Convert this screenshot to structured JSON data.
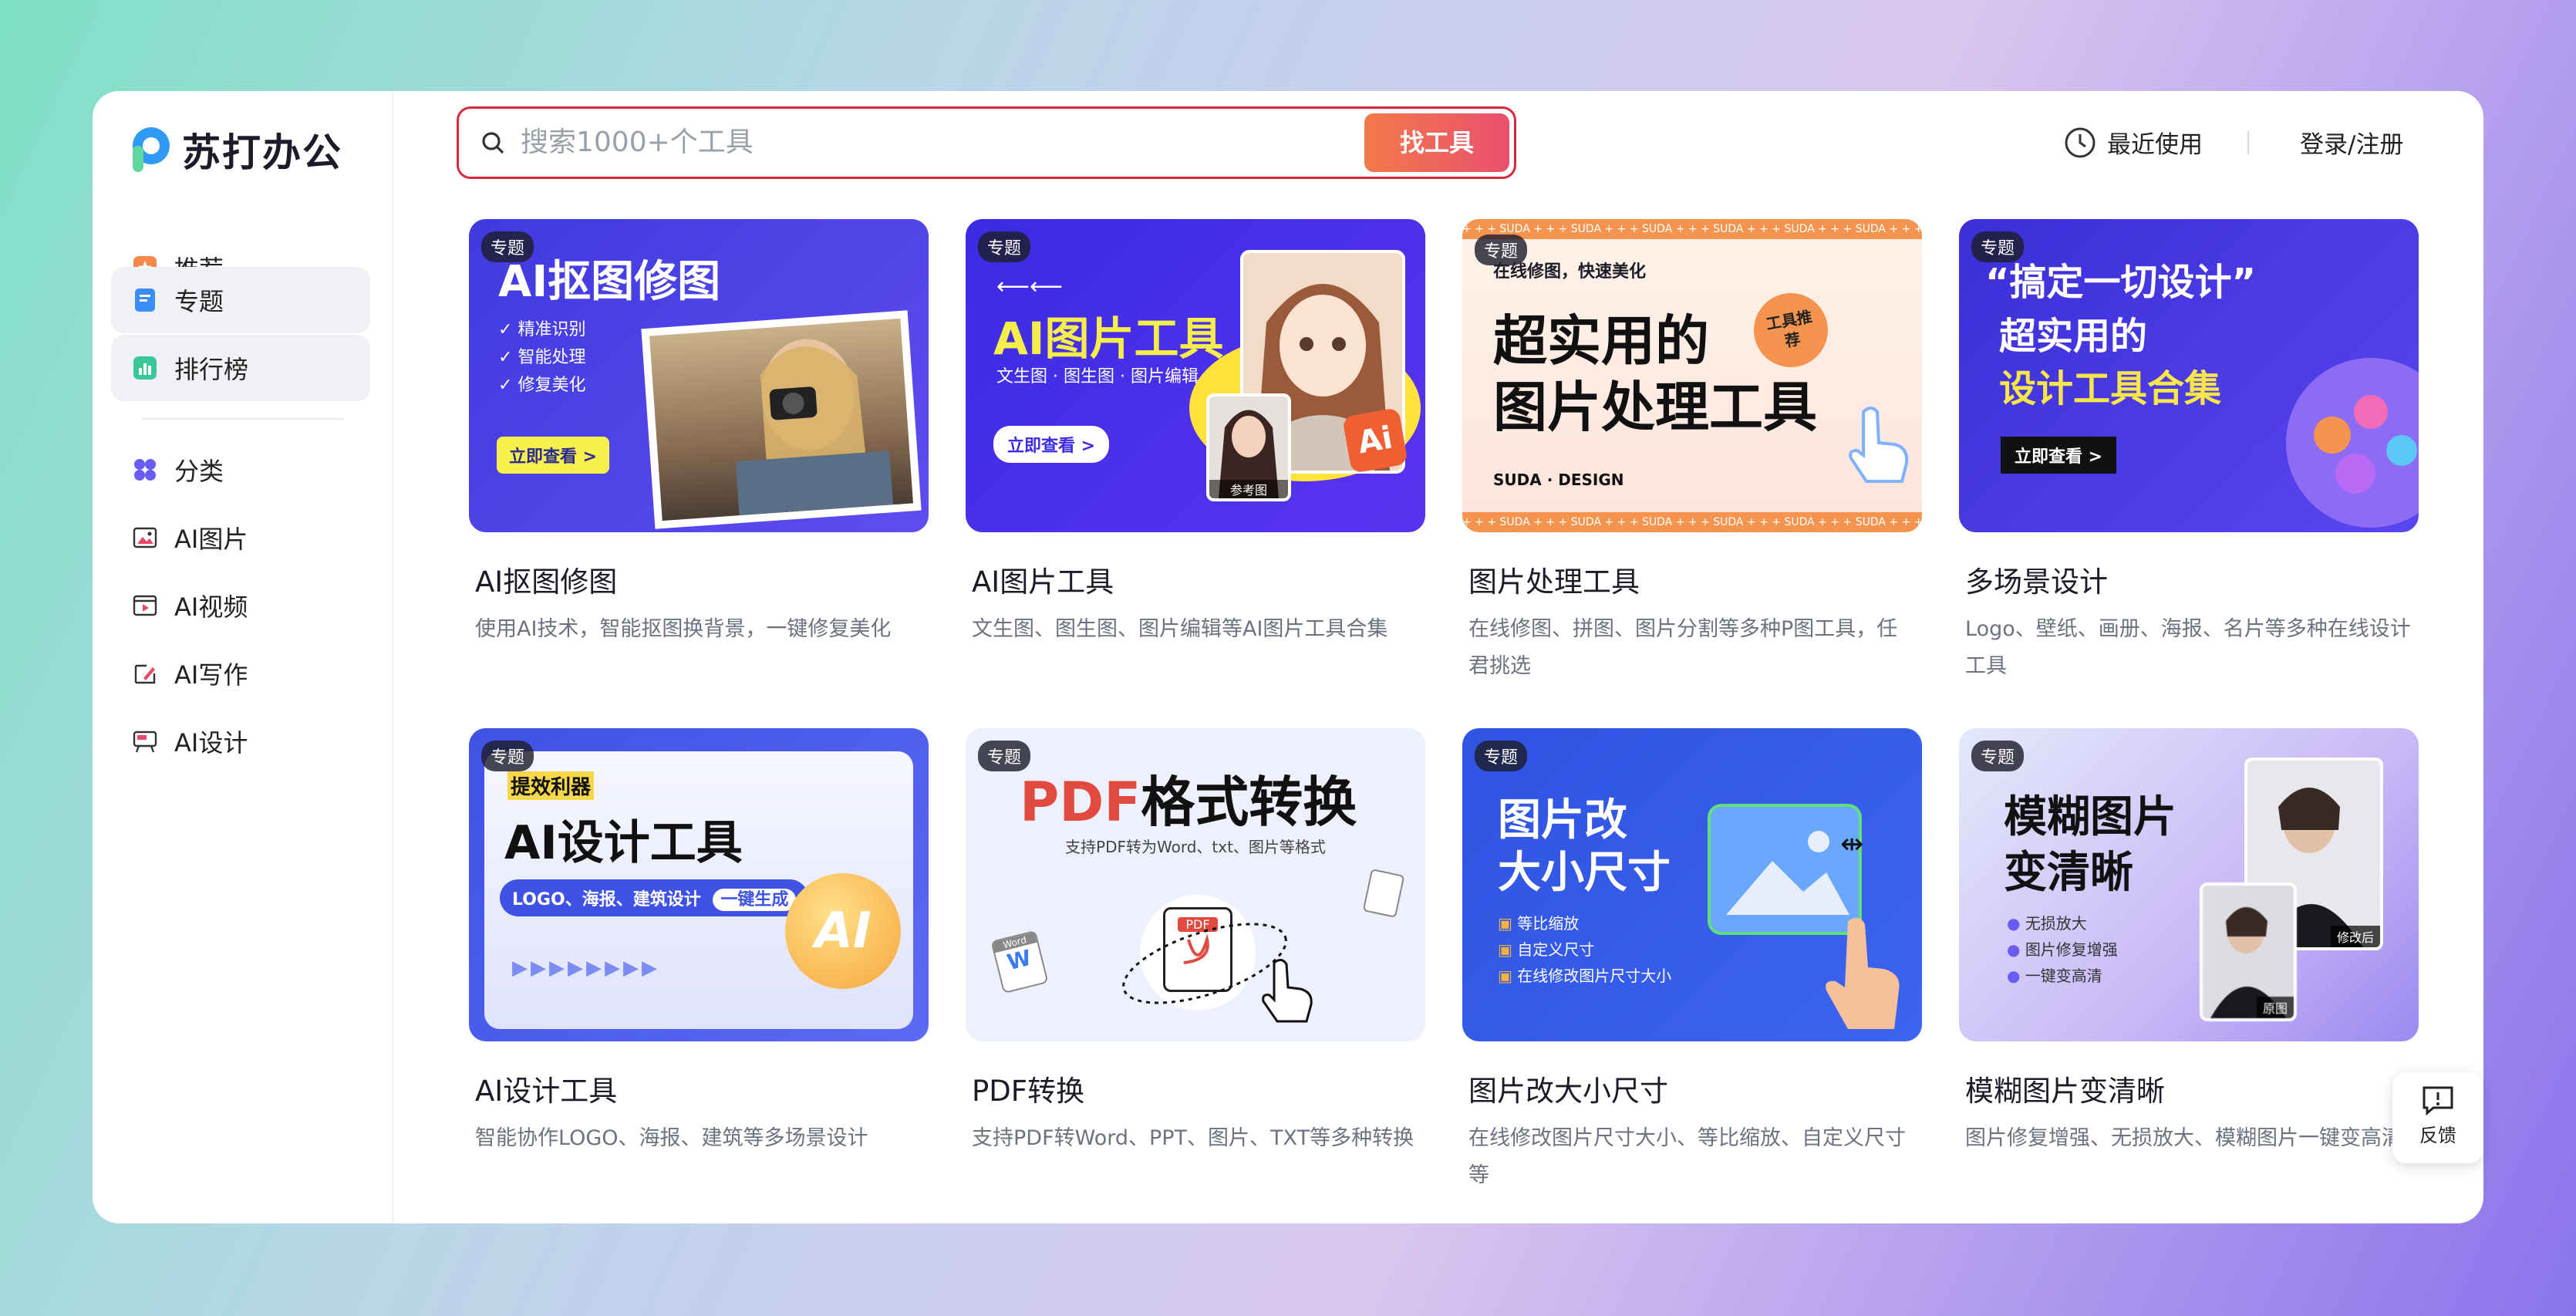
{
  "brand": {
    "name": "苏打办公"
  },
  "sidebar": {
    "items": [
      {
        "label": "推荐",
        "icon": "star-icon"
      },
      {
        "label": "专题",
        "icon": "bookmark-icon"
      },
      {
        "label": "排行榜",
        "icon": "chart-icon"
      },
      {
        "label": "分类",
        "icon": "grid-icon"
      },
      {
        "label": "AI图片",
        "icon": "image-icon"
      },
      {
        "label": "AI视频",
        "icon": "video-icon"
      },
      {
        "label": "AI写作",
        "icon": "pen-icon"
      },
      {
        "label": "AI设计",
        "icon": "design-icon"
      }
    ],
    "active": "专题"
  },
  "search": {
    "placeholder": "搜索1000+个工具",
    "button": "找工具"
  },
  "header": {
    "recent": "最近使用",
    "login": "登录/注册"
  },
  "cards": [
    {
      "tag": "专题",
      "title": "AI抠图修图",
      "desc": "使用AI技术，智能抠图换背景，一键修复美化",
      "banner": {
        "heading": "AI抠图修图",
        "bullets": [
          "精准识别",
          "智能处理",
          "修复美化"
        ],
        "cta": "立即查看 >"
      }
    },
    {
      "tag": "专题",
      "title": "AI图片工具",
      "desc": "文生图、图生图、图片编辑等AI图片工具合集",
      "banner": {
        "heading": "AI图片工具",
        "sub": "文生图 · 图生图 · 图片编辑",
        "cta": "立即查看 >",
        "ref": "参考图",
        "badge": "Ai"
      }
    },
    {
      "tag": "专题",
      "title": "图片处理工具",
      "desc": "在线修图、拼图、图片分割等多种P图工具，任君挑选",
      "banner": {
        "top": "在线修图，快速美化",
        "line1": "超实用的",
        "line2": "图片处理工具",
        "stamp": "工具推荐",
        "foot": "SUDA · DESIGN",
        "strip": "+ + + SUDA + + + SUDA + + + SUDA + + + SUDA + + + SUDA + + + SUDA + + +"
      }
    },
    {
      "tag": "专题",
      "title": "多场景设计",
      "desc": "Logo、壁纸、画册、海报、名片等多种在线设计工具",
      "banner": {
        "line1": "“搞定一切设计”",
        "line2": "超实用的",
        "line3": "设计工具合集",
        "cta": "立即查看 >"
      }
    },
    {
      "tag": "专题",
      "title": "AI设计工具",
      "desc": "智能协作LOGO、海报、建筑等多场景设计",
      "banner": {
        "small": "提效利器",
        "heading": "AI设计工具",
        "pill": "LOGO、海报、建筑设计",
        "pill_btn": "一键生成",
        "badge": "AI"
      }
    },
    {
      "tag": "专题",
      "title": "PDF转换",
      "desc": "支持PDF转Word、PPT、图片、TXT等多种转换",
      "banner": {
        "pdf": "PDF",
        "heading": "格式转换",
        "sub": "支持PDF转为Word、txt、图片等格式",
        "doc": "PDF",
        "word": "Word",
        "w": "W"
      }
    },
    {
      "tag": "专题",
      "title": "图片改大小尺寸",
      "desc": "在线修改图片尺寸大小、等比缩放、自定义尺寸等",
      "banner": {
        "line1": "图片改",
        "line2": "大小尺寸",
        "bullets": [
          "等比缩放",
          "自定义尺寸",
          "在线修改图片尺寸大小"
        ]
      }
    },
    {
      "tag": "专题",
      "title": "模糊图片变清晰",
      "desc": "图片修复增强、无损放大、模糊图片一键变高清",
      "banner": {
        "line1": "模糊图片",
        "line2": "变清晰",
        "bullets": [
          "无损放大",
          "图片修复增强",
          "一键变高清"
        ],
        "before": "原图",
        "after": "修改后"
      }
    }
  ],
  "feedback": {
    "label": "反馈"
  },
  "colors": {
    "accent": "#e8486a",
    "blue": "#3f3ae0",
    "orange": "#f4944e"
  }
}
